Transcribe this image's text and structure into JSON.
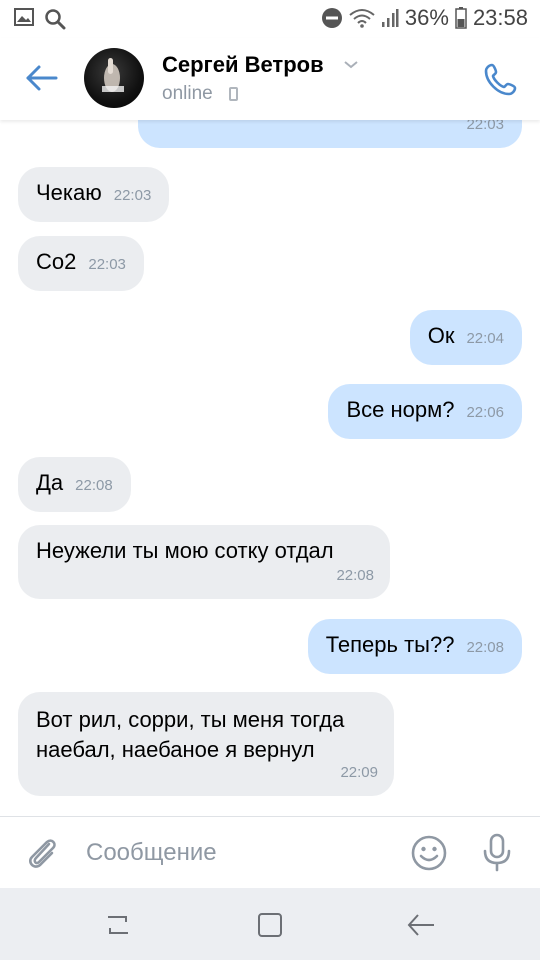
{
  "status_bar": {
    "battery": "36%",
    "time": "23:58",
    "icons": [
      "gallery-icon",
      "search-icon",
      "do-not-disturb-icon",
      "wifi-icon",
      "signal-icon",
      "battery-icon"
    ]
  },
  "header": {
    "name": "Сергей Ветров",
    "status": "online",
    "icons": [
      "back-arrow-icon",
      "chevron-down-icon",
      "mobile-device-icon",
      "phone-icon"
    ]
  },
  "messages": [
    {
      "dir": "out",
      "text": "",
      "time": "22:03"
    },
    {
      "dir": "in",
      "text": "Чекаю",
      "time": "22:03"
    },
    {
      "dir": "in",
      "text": "Со2",
      "time": "22:03"
    },
    {
      "dir": "out",
      "text": "Ок",
      "time": "22:04"
    },
    {
      "dir": "out",
      "text": "Все норм?",
      "time": "22:06"
    },
    {
      "dir": "in",
      "text": "Да",
      "time": "22:08"
    },
    {
      "dir": "in",
      "text": "Неужели ты мою сотку отдал",
      "time": "22:08"
    },
    {
      "dir": "out",
      "text": "Теперь ты??",
      "time": "22:08"
    },
    {
      "dir": "in",
      "text_lines": [
        "Вот рил, сорри, ты меня тогда",
        "наебал, наебаное я вернул"
      ],
      "time": "22:09"
    }
  ],
  "composer": {
    "placeholder": "Сообщение",
    "icons": [
      "attach-icon",
      "emoji-icon",
      "microphone-icon"
    ]
  },
  "nav_bar": {
    "icons": [
      "recent-apps-icon",
      "home-icon",
      "back-icon"
    ]
  },
  "colors": {
    "accent": "#4a88cc",
    "incoming_bubble": "#ebedf0",
    "outgoing_bubble": "#cce4ff",
    "meta_text": "#8d99a6"
  }
}
